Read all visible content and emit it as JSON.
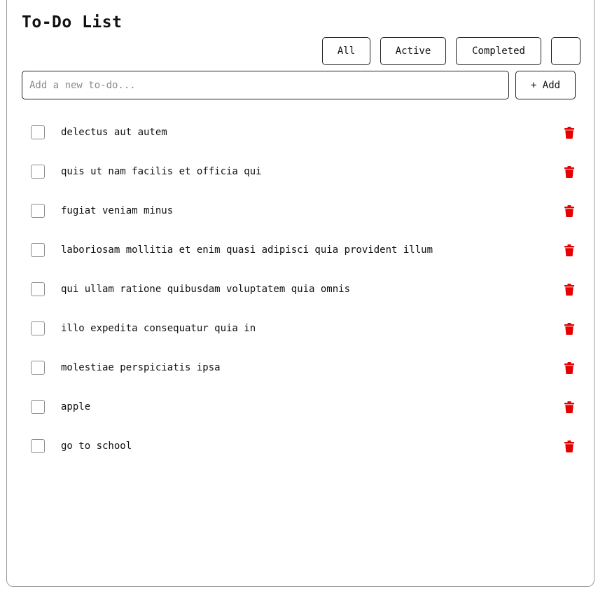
{
  "header": {
    "title": "To-Do List"
  },
  "filters": {
    "all_label": "All",
    "active_label": "Active",
    "completed_label": "Completed",
    "extra_label": ""
  },
  "new_todo": {
    "placeholder": "Add a new to-do...",
    "value": "",
    "add_label": "+ Add"
  },
  "todos": [
    {
      "text": "delectus aut autem",
      "completed": false
    },
    {
      "text": "quis ut nam facilis et officia qui",
      "completed": false
    },
    {
      "text": "fugiat veniam minus",
      "completed": false
    },
    {
      "text": "laboriosam mollitia et enim quasi adipisci quia provident illum",
      "completed": false
    },
    {
      "text": "qui ullam ratione quibusdam voluptatem quia omnis",
      "completed": false
    },
    {
      "text": "illo expedita consequatur quia in",
      "completed": false
    },
    {
      "text": "molestiae perspiciatis ipsa",
      "completed": false
    },
    {
      "text": "apple",
      "completed": false
    },
    {
      "text": "go to school",
      "completed": false
    }
  ],
  "icons": {
    "delete": "trash-icon"
  },
  "colors": {
    "delete_icon": "#e60000",
    "border": "#222222"
  }
}
